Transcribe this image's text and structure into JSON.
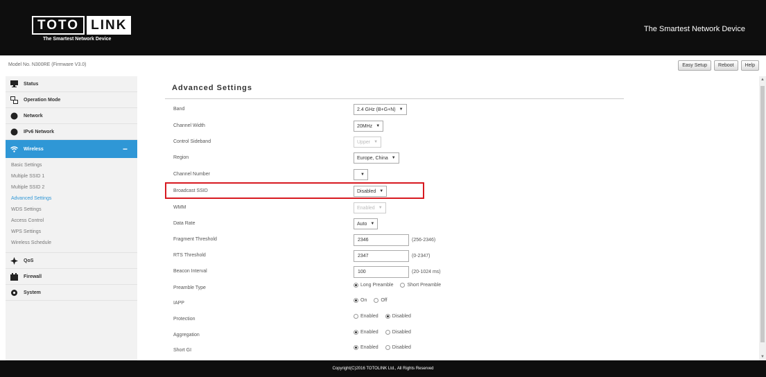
{
  "header": {
    "logo_left": "TOTO",
    "logo_right": "LINK",
    "logo_tagline": "The Smartest Network Device",
    "slogan": "The Smartest Network Device"
  },
  "topbar": {
    "model": "Model No. N300RE (Firmware V3.0)",
    "buttons": [
      "Easy Setup",
      "Reboot",
      "Help"
    ]
  },
  "sidebar": {
    "items": [
      {
        "label": "Status",
        "icon": "monitor-icon"
      },
      {
        "label": "Operation Mode",
        "icon": "network-mode-icon"
      },
      {
        "label": "Network",
        "icon": "globe-icon"
      },
      {
        "label": "IPv6 Network",
        "icon": "globe-icon"
      },
      {
        "label": "Wireless",
        "icon": "wifi-icon",
        "active": true,
        "collapse": "−"
      },
      {
        "label": "QoS",
        "icon": "qos-icon"
      },
      {
        "label": "Firewall",
        "icon": "firewall-icon"
      },
      {
        "label": "System",
        "icon": "gear-icon"
      }
    ],
    "wireless_subitems": [
      "Basic Settings",
      "Multiple SSID 1",
      "Multiple SSID 2",
      "Advanced Settings",
      "WDS Settings",
      "Access Control",
      "WPS Settings",
      "Wireless Schedule"
    ]
  },
  "main": {
    "title": "Advanced Settings",
    "band": {
      "label": "Band",
      "value": "2.4 GHz (B+G+N)"
    },
    "channel_width": {
      "label": "Channel Width",
      "value": "20MHz"
    },
    "control_sideband": {
      "label": "Control Sideband",
      "value": "Upper"
    },
    "region": {
      "label": "Region",
      "value": "Europe, China"
    },
    "channel_number": {
      "label": "Channel Number",
      "value": ""
    },
    "broadcast_ssid": {
      "label": "Broadcast SSID",
      "value": "Disabled"
    },
    "wmm": {
      "label": "WMM",
      "value": "Enabled"
    },
    "data_rate": {
      "label": "Data Rate",
      "value": "Auto"
    },
    "fragment_threshold": {
      "label": "Fragment Threshold",
      "value": "2346",
      "hint": "(256-2346)"
    },
    "rts_threshold": {
      "label": "RTS Threshold",
      "value": "2347",
      "hint": "(0-2347)"
    },
    "beacon_interval": {
      "label": "Beacon Interval",
      "value": "100",
      "hint": "(20-1024 ms)"
    },
    "preamble_type": {
      "label": "Preamble Type",
      "options": [
        "Long Preamble",
        "Short Preamble"
      ],
      "selected": 0
    },
    "iapp": {
      "label": "IAPP",
      "options": [
        "On",
        "Off"
      ],
      "selected": 0
    },
    "protection": {
      "label": "Protection",
      "options": [
        "Enabled",
        "Disabled"
      ],
      "selected": 1
    },
    "aggregation": {
      "label": "Aggregation",
      "options": [
        "Enabled",
        "Disabled"
      ],
      "selected": 0
    },
    "short_gi": {
      "label": "Short GI",
      "options": [
        "Enabled",
        "Disabled"
      ],
      "selected": 0
    }
  },
  "footer": {
    "copyright": "Copyright(C)2016 TOTOLINK Ltd., All Rights Reserved"
  },
  "colors": {
    "accent": "#2f97d6",
    "highlight": "#d71920",
    "header": "#0e0e0e"
  }
}
